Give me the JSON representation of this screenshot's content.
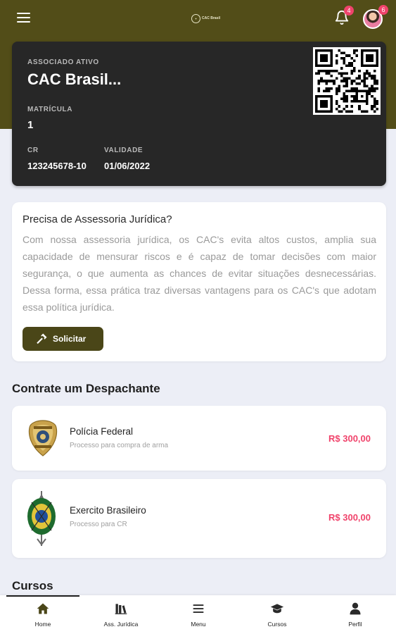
{
  "header": {
    "logo_text": "CAC Brasil",
    "notifications_count": "4",
    "profile_count": "6"
  },
  "member_card": {
    "status_label": "ASSOCIADO ATIVO",
    "name": "CAC Brasil...",
    "matricula_label": "MATRÍCULA",
    "matricula_value": "1",
    "cr_label": "CR",
    "cr_value": "123245678-10",
    "validade_label": "VALIDADE",
    "validade_value": "01/06/2022"
  },
  "legal": {
    "title": "Precisa de Assessoria Jurídica?",
    "text": "Com nossa assessoria jurídica, os CAC's evita altos custos, amplia sua capacidade de mensurar riscos e é capaz de tomar decisões com maior segurança, o que aumenta as chances de evitar situações desnecessárias. Dessa forma, essa prática traz diversas vantagens para os CAC's que adotam essa política jurídica.",
    "button_label": "Solicitar"
  },
  "despachante": {
    "section_title": "Contrate um Despachante",
    "services": [
      {
        "name": "Polícia Federal",
        "description": "Processo para compra de arma",
        "price": "R$ 300,00"
      },
      {
        "name": "Exercito Brasileiro",
        "description": "Processo para CR",
        "price": "R$ 300,00"
      }
    ]
  },
  "cursos": {
    "section_title": "Cursos"
  },
  "bottom_nav": {
    "items": [
      {
        "label": "Home",
        "icon": "home-icon"
      },
      {
        "label": "Ass. Jurídica",
        "icon": "books-icon"
      },
      {
        "label": "Menu",
        "icon": "menu-icon"
      },
      {
        "label": "Cursos",
        "icon": "graduation-cap-icon"
      },
      {
        "label": "Perfil",
        "icon": "user-icon"
      }
    ]
  },
  "colors": {
    "brand": "#524d18",
    "card_dark": "#272727",
    "price": "#f0436b",
    "background": "#eceef6"
  }
}
